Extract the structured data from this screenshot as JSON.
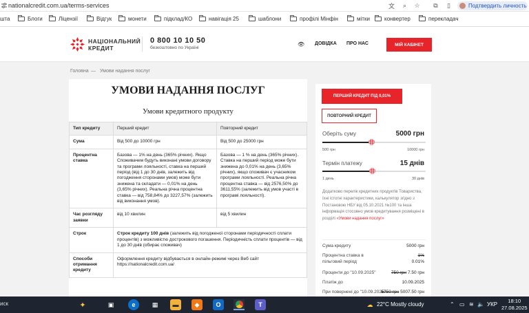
{
  "browser": {
    "url": "nationalcredit.com.ua/terms-services",
    "profile_label": "Подтвердить личность"
  },
  "bookmarks": [
    "шта",
    "Блоги",
    "Ліцензії",
    "Відгук",
    "монети",
    "підклад/КО",
    "навігація 25",
    "шаблони",
    "профілі Мінфін",
    "мітки",
    "конвертер",
    "перекладач"
  ],
  "header": {
    "logo_line1": "НАЦІОНАЛЬНИЙ",
    "logo_line2": "КРЕДИТ",
    "phone": "0 800 10 10 50",
    "phone_note": "безкоштовно по Україні",
    "nav": [
      "ДОВІДКА",
      "ПРО НАС"
    ],
    "cabinet": "МІЙ КАБІНЕТ"
  },
  "breadcrumb": {
    "home": "Головна",
    "sep": "—",
    "current": "Умови надання послуг"
  },
  "main": {
    "title": "УМОВИ НАДАННЯ ПОСЛУГ",
    "subtitle": "Умови кредитного продукту",
    "table": {
      "head": [
        "Тип кредиту",
        "Перший кредит",
        "Повторний кредит"
      ],
      "rows": [
        {
          "label": "Сума",
          "c1": "Від 500 до 10000 грн",
          "c2": "Від 500 до 25000 грн"
        },
        {
          "label": "Процентна ставка",
          "c1": "Базова — 1% на день (365% річних). Якщо Споживачем будуть виконані умови договору та програми лояльності, ставка на перший період (від 1 до 30 днів, залежить від погодження сторонами умов) може бути знижена та складати — 0,01% на день (3,65% річних). Реальна річна процентна ставка — від 758,84% до 3227,57% (залежить від виконання умов).",
          "c2": "Базова — 1 % на день (365% річних). Ставка на перший період може бути знижена до 0,01% на день (3,65% річних), якщо споживач є учасником програми лояльності. Реальна річна процентна ставка — від 2576,50% до 3611,55% (залежить від умов участі в програмі лояльності)."
        },
        {
          "label": "Час розгляду заявки",
          "c1": "від 10 хвилин",
          "c2": "від 5 хвилин"
        },
        {
          "label": "Строк",
          "span_bold": "Строк кредиту 100 днів",
          "span_rest": " (залежить від погодженої сторонами періодичності сплати процентів) з можливістю дострокового погашення. Періодичність сплати процентів — від 1 до 30 днів (обирає споживач)"
        },
        {
          "label": "Способи отримання кредиту",
          "span_text": "Оформлення кредиту відбувається в онлайн-режимі через Веб сайт https://nationalcredit.com.ua/"
        }
      ]
    }
  },
  "calculator": {
    "tab_first": "ПЕРШИЙ КРЕДИТ ПІД 0,01%",
    "tab_repeat": "ПОВТОРНИЙ КРЕДИТ",
    "amount_label": "Оберіть суму",
    "amount_value": "5000 грн",
    "amount_min": "500 грн",
    "amount_max": "10000 грн",
    "amount_fraction": 0.47,
    "term_label": "Термін платежу",
    "term_value": "15 днів",
    "term_min": "1 день",
    "term_max": "30 днів",
    "term_fraction": 0.48,
    "notice_text": "Додатково перелік кредитних продуктів Товариства, їхні істотні характеристики, калькулятор згідно з Постановою НБУ від 05.10.2021 №100 та інша інформація стосовно умов кредитування розміщені в розділі",
    "notice_link": "«Умови надання послуг»",
    "summary": [
      {
        "label": "Сума кредиту",
        "value": "5000 грн"
      },
      {
        "label": "Процентна ставка в пільговий період",
        "value_old": "1%",
        "value": "0.01%"
      },
      {
        "label": "Проценти до \"10.09.2025\"",
        "value_old": "750 грн",
        "value": "7.50 грн"
      },
      {
        "label": "Платіж до",
        "value": "10.09.2025"
      },
      {
        "label": "При повернені до \"10.09.2025\"",
        "value_old": "5750 грн",
        "value": "5007.50 грн"
      }
    ]
  },
  "taskbar": {
    "search": "иск",
    "weather": "22°C  Mostly cloudy",
    "lang": "УКР",
    "time": "18:10",
    "date": "27.08.2025"
  }
}
